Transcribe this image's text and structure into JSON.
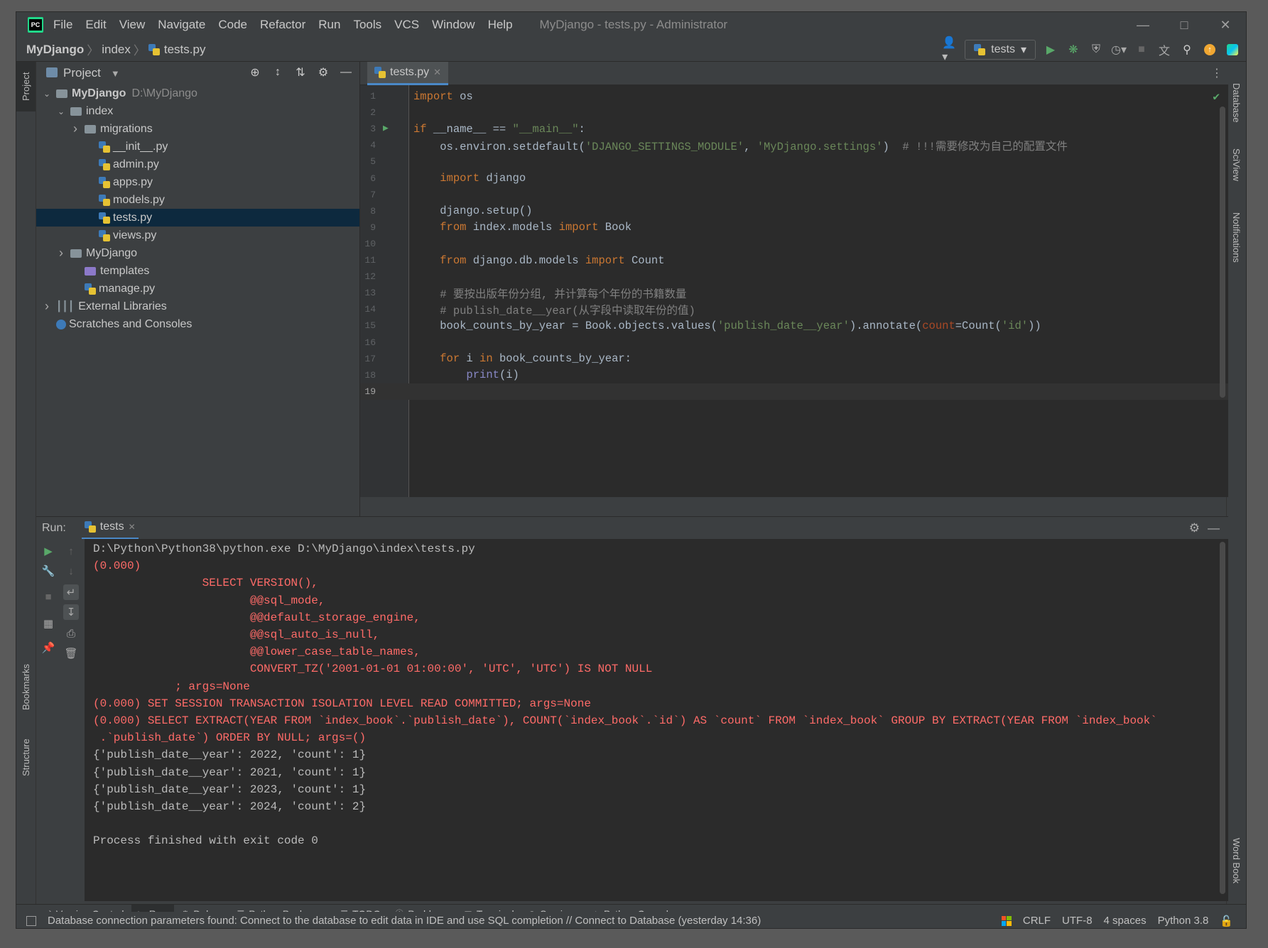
{
  "window": {
    "title": "MyDjango - tests.py - Administrator",
    "menu": [
      "File",
      "Edit",
      "View",
      "Navigate",
      "Code",
      "Refactor",
      "Run",
      "Tools",
      "VCS",
      "Window",
      "Help"
    ]
  },
  "breadcrumb": [
    "MyDjango",
    "index",
    "tests.py"
  ],
  "run_config": "tests",
  "project_panel": {
    "title": "Project",
    "tree": [
      {
        "label": "MyDjango",
        "extra": "D:\\MyDjango",
        "depth": 0,
        "type": "folder",
        "arrow": "open",
        "bold": true
      },
      {
        "label": "index",
        "depth": 1,
        "type": "folder",
        "arrow": "open"
      },
      {
        "label": "migrations",
        "depth": 2,
        "type": "folder",
        "arrow": "closed"
      },
      {
        "label": "__init__.py",
        "depth": 3,
        "type": "py"
      },
      {
        "label": "admin.py",
        "depth": 3,
        "type": "py"
      },
      {
        "label": "apps.py",
        "depth": 3,
        "type": "py"
      },
      {
        "label": "models.py",
        "depth": 3,
        "type": "py"
      },
      {
        "label": "tests.py",
        "depth": 3,
        "type": "py",
        "selected": true
      },
      {
        "label": "views.py",
        "depth": 3,
        "type": "py"
      },
      {
        "label": "MyDjango",
        "depth": 1,
        "type": "folder",
        "arrow": "closed"
      },
      {
        "label": "templates",
        "depth": 2,
        "type": "folder-purple"
      },
      {
        "label": "manage.py",
        "depth": 2,
        "type": "py"
      },
      {
        "label": "External Libraries",
        "depth": 0,
        "type": "lib",
        "arrow": "closed"
      },
      {
        "label": "Scratches and Consoles",
        "depth": 0,
        "type": "scratch"
      }
    ]
  },
  "editor": {
    "tab": "tests.py",
    "current_line": 19,
    "lines": [
      [
        [
          "kw",
          "import"
        ],
        [
          "",
          " os"
        ]
      ],
      [],
      [
        [
          "kw",
          "if"
        ],
        [
          "",
          " __name__ == "
        ],
        [
          "str",
          "\"__main__\""
        ],
        [
          "",
          ":"
        ]
      ],
      [
        [
          "",
          "    os.environ.setdefault("
        ],
        [
          "str",
          "'DJANGO_SETTINGS_MODULE'"
        ],
        [
          "",
          ", "
        ],
        [
          "str",
          "'MyDjango.settings'"
        ],
        [
          "",
          ")  "
        ],
        [
          "cmt",
          "# !!!需要修改为自己的配置文件"
        ]
      ],
      [],
      [
        [
          "",
          "    "
        ],
        [
          "kw",
          "import"
        ],
        [
          "",
          " django"
        ]
      ],
      [],
      [
        [
          "",
          "    django.setup()"
        ]
      ],
      [
        [
          "",
          "    "
        ],
        [
          "kw",
          "from"
        ],
        [
          "",
          " index.models "
        ],
        [
          "kw",
          "import"
        ],
        [
          "",
          " Book"
        ]
      ],
      [],
      [
        [
          "",
          "    "
        ],
        [
          "kw",
          "from"
        ],
        [
          "",
          " django.db.models "
        ],
        [
          "kw",
          "import"
        ],
        [
          "",
          " Count"
        ]
      ],
      [],
      [
        [
          "",
          "    "
        ],
        [
          "cmt",
          "# 要按出版年份分组, 并计算每个年份的书籍数量"
        ]
      ],
      [
        [
          "",
          "    "
        ],
        [
          "cmt",
          "# publish_date__year(从字段中读取年份的值)"
        ]
      ],
      [
        [
          "",
          "    book_counts_by_year = Book.objects.values("
        ],
        [
          "str",
          "'publish_date__year'"
        ],
        [
          "",
          ").annotate("
        ],
        [
          "param",
          "count"
        ],
        [
          "",
          "=Count("
        ],
        [
          "str",
          "'id'"
        ],
        [
          "",
          "))"
        ]
      ],
      [],
      [
        [
          "",
          "    "
        ],
        [
          "kw",
          "for"
        ],
        [
          "",
          " i "
        ],
        [
          "kw",
          "in"
        ],
        [
          "",
          " book_counts_by_year:"
        ]
      ],
      [
        [
          "",
          "        "
        ],
        [
          "bi",
          "print"
        ],
        [
          "",
          "(i)"
        ]
      ],
      []
    ]
  },
  "run_panel": {
    "label": "Run:",
    "tab": "tests",
    "output": [
      {
        "style": "normal",
        "text": "D:\\Python\\Python38\\python.exe D:\\MyDjango\\index\\tests.py"
      },
      {
        "style": "err",
        "text": "(0.000)"
      },
      {
        "style": "err",
        "text": "                SELECT VERSION(),"
      },
      {
        "style": "err",
        "text": "                       @@sql_mode,"
      },
      {
        "style": "err",
        "text": "                       @@default_storage_engine,"
      },
      {
        "style": "err",
        "text": "                       @@sql_auto_is_null,"
      },
      {
        "style": "err",
        "text": "                       @@lower_case_table_names,"
      },
      {
        "style": "err",
        "text": "                       CONVERT_TZ('2001-01-01 01:00:00', 'UTC', 'UTC') IS NOT NULL"
      },
      {
        "style": "err",
        "text": "            ; args=None"
      },
      {
        "style": "err",
        "text": "(0.000) SET SESSION TRANSACTION ISOLATION LEVEL READ COMMITTED; args=None"
      },
      {
        "style": "err",
        "text": "(0.000) SELECT EXTRACT(YEAR FROM `index_book`.`publish_date`), COUNT(`index_book`.`id`) AS `count` FROM `index_book` GROUP BY EXTRACT(YEAR FROM `index_book`"
      },
      {
        "style": "err",
        "text": " .`publish_date`) ORDER BY NULL; args=()"
      },
      {
        "style": "normal",
        "text": "{'publish_date__year': 2022, 'count': 1}"
      },
      {
        "style": "normal",
        "text": "{'publish_date__year': 2021, 'count': 1}"
      },
      {
        "style": "normal",
        "text": "{'publish_date__year': 2023, 'count': 1}"
      },
      {
        "style": "normal",
        "text": "{'publish_date__year': 2024, 'count': 2}"
      },
      {
        "style": "normal",
        "text": ""
      },
      {
        "style": "normal",
        "text": "Process finished with exit code 0"
      }
    ]
  },
  "left_strip": {
    "project": "Project",
    "bookmarks": "Bookmarks",
    "structure": "Structure"
  },
  "right_strip": {
    "database": "Database",
    "sciview": "SciView",
    "notifications": "Notifications",
    "wordbook": "Word Book"
  },
  "bottom_tools": [
    {
      "label": "Version Control",
      "icon": "branch-icon"
    },
    {
      "label": "Run",
      "icon": "run-icon",
      "active": true
    },
    {
      "label": "Debug",
      "icon": "bug-icon"
    },
    {
      "label": "Python Packages",
      "icon": "layers-icon"
    },
    {
      "label": "TODO",
      "icon": "list-icon"
    },
    {
      "label": "Problems",
      "icon": "info-icon"
    },
    {
      "label": "Terminal",
      "icon": "terminal-icon"
    },
    {
      "label": "Services",
      "icon": "services-icon"
    },
    {
      "label": "Python Console",
      "icon": "python-icon"
    }
  ],
  "status": {
    "message": "Database connection parameters found: Connect to the database to edit data in IDE and use SQL completion // Connect to Database (yesterday 14:36)",
    "line_sep": "CRLF",
    "encoding": "UTF-8",
    "indent": "4 spaces",
    "interpreter": "Python 3.8"
  },
  "colors": {
    "accent": "#4a88c7",
    "run_green": "#59a869",
    "selection": "#0d293e",
    "error_text": "#ff6b68"
  }
}
